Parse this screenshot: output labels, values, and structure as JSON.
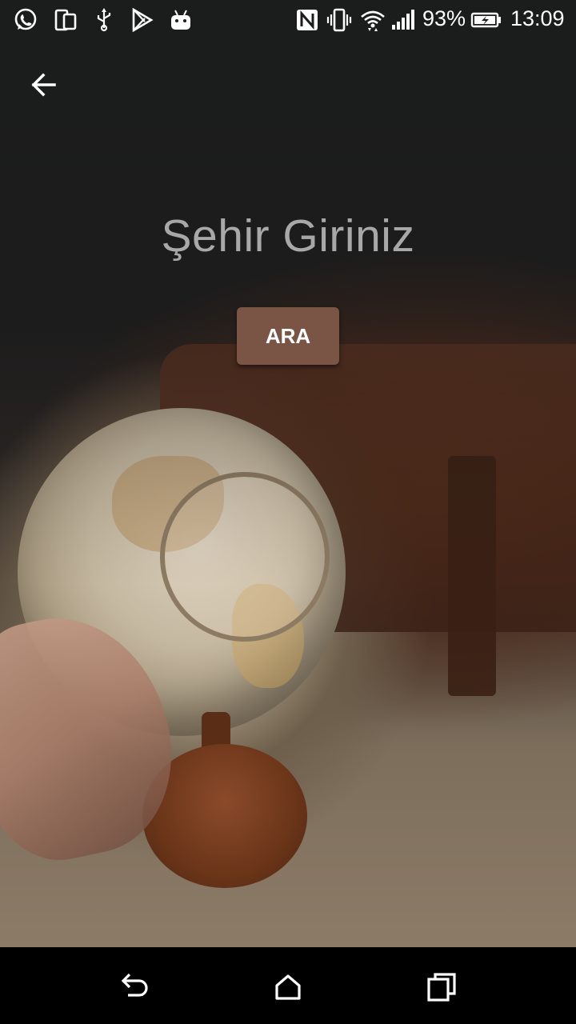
{
  "status_bar": {
    "left_icons": [
      "whatsapp-icon",
      "dual-screen-icon",
      "usb-icon",
      "play-store-icon",
      "android-icon"
    ],
    "right_icons": [
      "nfc-icon",
      "vibrate-icon",
      "wifi-icon",
      "signal-icon",
      "battery-icon"
    ],
    "battery_percent": "93%",
    "time": "13:09"
  },
  "header": {
    "back_icon": "arrow-back-icon"
  },
  "main": {
    "title": "Şehir Giriniz",
    "search_button_label": "ARA",
    "search_button_color": "#7a5546",
    "title_color": "#a8a8a8"
  },
  "nav_bar": {
    "buttons": [
      "back-icon",
      "home-icon",
      "recents-icon"
    ]
  }
}
